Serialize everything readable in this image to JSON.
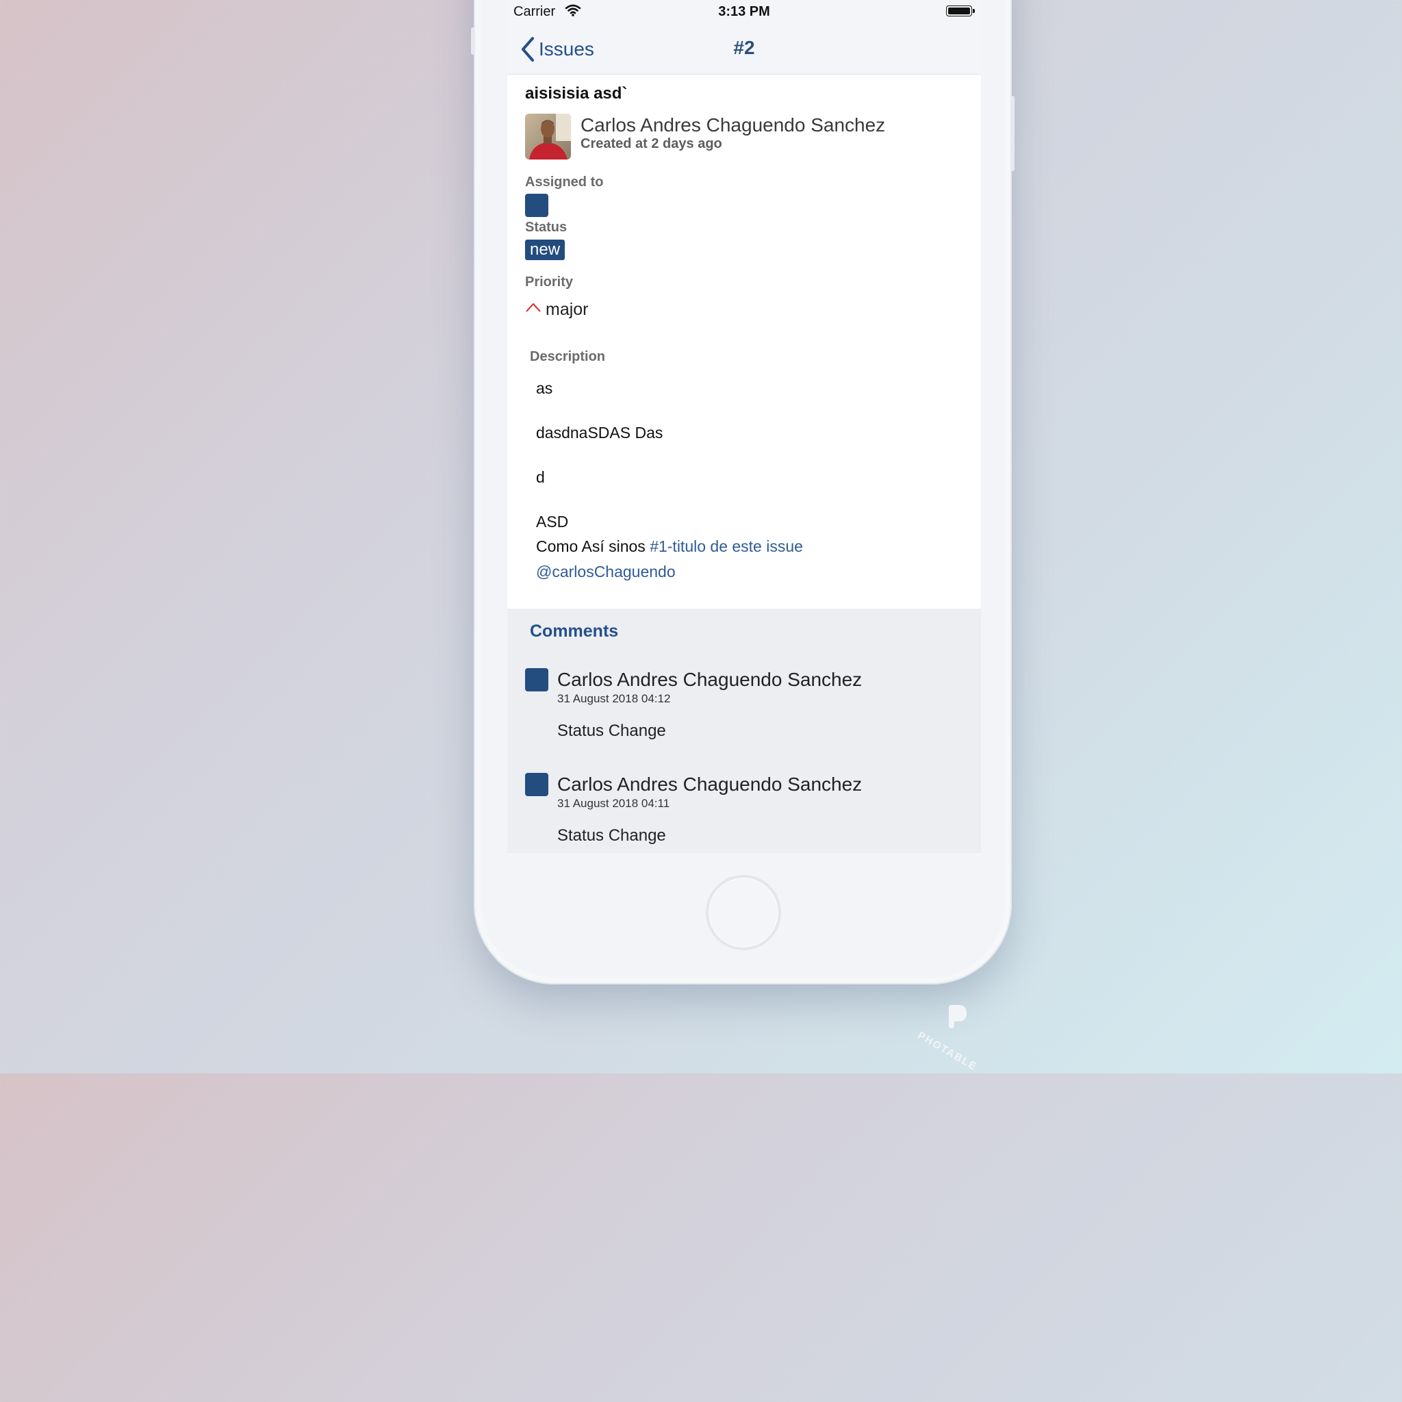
{
  "status_bar": {
    "carrier": "Carrier",
    "time": "3:13 PM"
  },
  "nav": {
    "back_label": "Issues",
    "title": "#2"
  },
  "issue": {
    "title": "aisisisia asd`",
    "author": "Carlos Andres Chaguendo Sanchez",
    "created": "Created at 2 days ago",
    "assigned_label": "Assigned to",
    "status_label": "Status",
    "status_value": "new",
    "priority_label": "Priority",
    "priority_value": "major",
    "description_label": "Description",
    "description": {
      "line1": "as",
      "line2": "dasdnaSDAS Das",
      "line3": "d",
      "line4": "ASD",
      "line5_text": "Como Así sinos ",
      "line5_link": "#1-titulo de este issue",
      "line6_link": "@carlosChaguendo"
    }
  },
  "comments": {
    "title": "Comments",
    "items": [
      {
        "author": "Carlos Andres Chaguendo Sanchez",
        "date": "31 August 2018 04:12",
        "body": "Status Change"
      },
      {
        "author": "Carlos Andres Chaguendo Sanchez",
        "date": "31 August 2018 04:11",
        "body": "Status Change"
      }
    ]
  },
  "watermark": "PHOTABLE",
  "icons": {
    "back": "chevron-left-icon",
    "priority": "chevron-up-icon",
    "wifi": "wifi-icon",
    "battery": "battery-icon"
  },
  "colors": {
    "accent": "#24508a",
    "badge": "#234c7f",
    "priority": "#d0413b"
  }
}
